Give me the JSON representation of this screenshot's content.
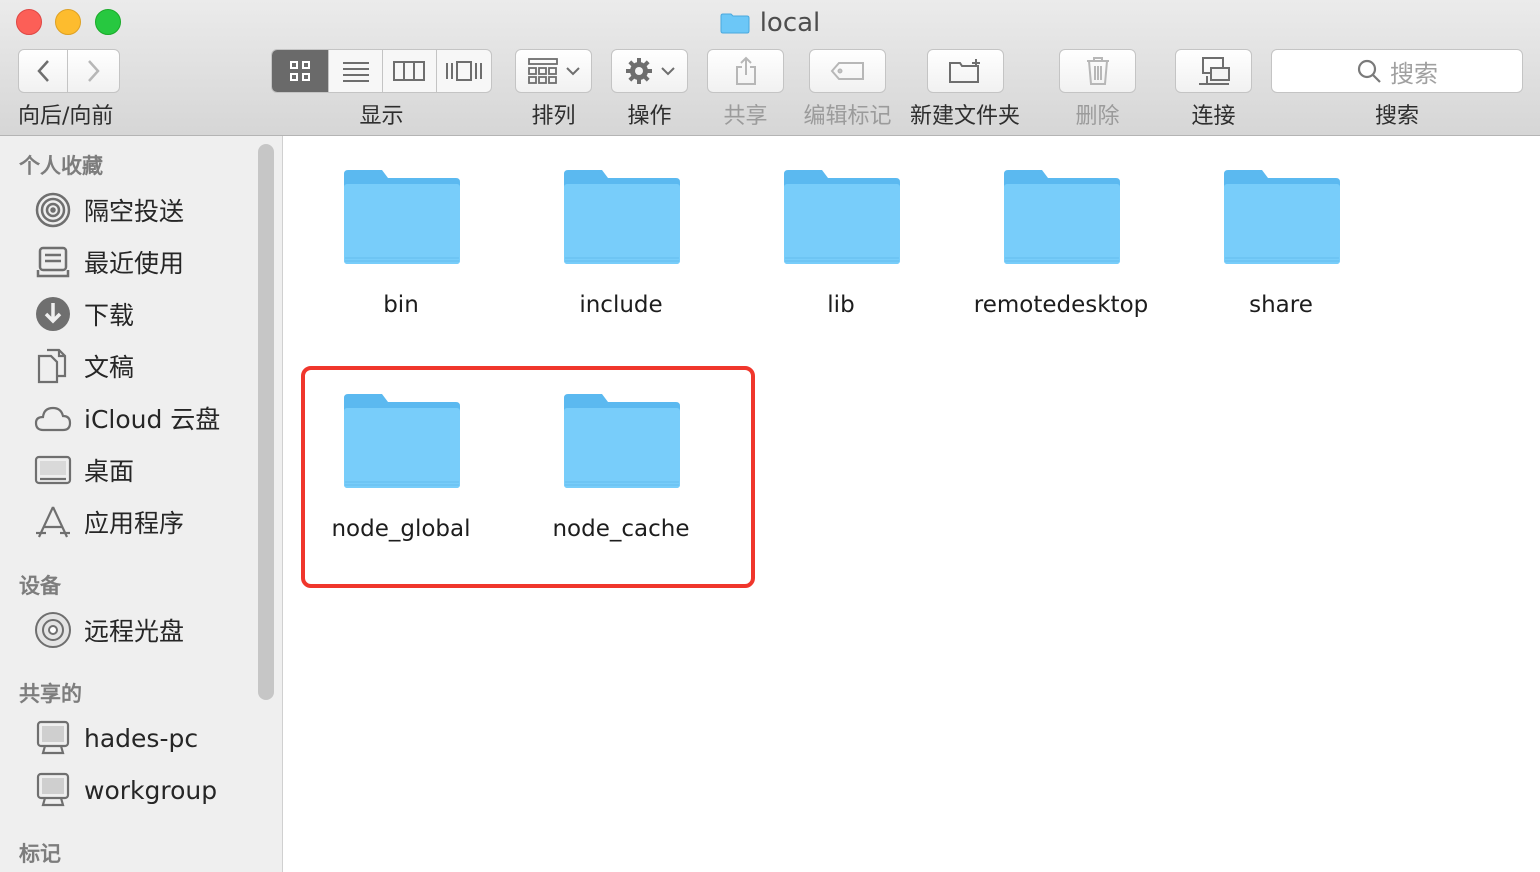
{
  "window": {
    "title": "local",
    "traffic_lights": [
      "close",
      "minimize",
      "maximize"
    ]
  },
  "toolbar": {
    "nav_label": "向后/向前",
    "view_label": "显示",
    "arrange_label": "排列",
    "action_label": "操作",
    "share_label": "共享",
    "edit_tags_label": "编辑标记",
    "new_folder_label": "新建文件夹",
    "delete_label": "删除",
    "connect_label": "连接",
    "search_label": "搜索",
    "search_placeholder": "搜索",
    "active_view": "icon"
  },
  "sidebar": {
    "favorites_heading": "个人收藏",
    "favorites": [
      {
        "label": "隔空投送",
        "icon": "airdrop-icon"
      },
      {
        "label": "最近使用",
        "icon": "recents-icon"
      },
      {
        "label": "下载",
        "icon": "downloads-icon"
      },
      {
        "label": "文稿",
        "icon": "documents-icon"
      },
      {
        "label": "iCloud 云盘",
        "icon": "icloud-icon"
      },
      {
        "label": "桌面",
        "icon": "desktop-icon"
      },
      {
        "label": "应用程序",
        "icon": "applications-icon"
      }
    ],
    "devices_heading": "设备",
    "devices": [
      {
        "label": "远程光盘",
        "icon": "disc-icon"
      }
    ],
    "shared_heading": "共享的",
    "shared": [
      {
        "label": "hades-pc",
        "icon": "computer-icon"
      },
      {
        "label": "workgroup",
        "icon": "computer-icon"
      }
    ],
    "tags_heading": "标记"
  },
  "files": [
    {
      "name": "bin"
    },
    {
      "name": "include"
    },
    {
      "name": "lib"
    },
    {
      "name": "remotedesktop"
    },
    {
      "name": "share"
    },
    {
      "name": "node_global"
    },
    {
      "name": "node_cache"
    }
  ],
  "colors": {
    "folder": "#6cc7f7",
    "highlight": "#f0362c",
    "active_segment": "#6a6a6a"
  }
}
